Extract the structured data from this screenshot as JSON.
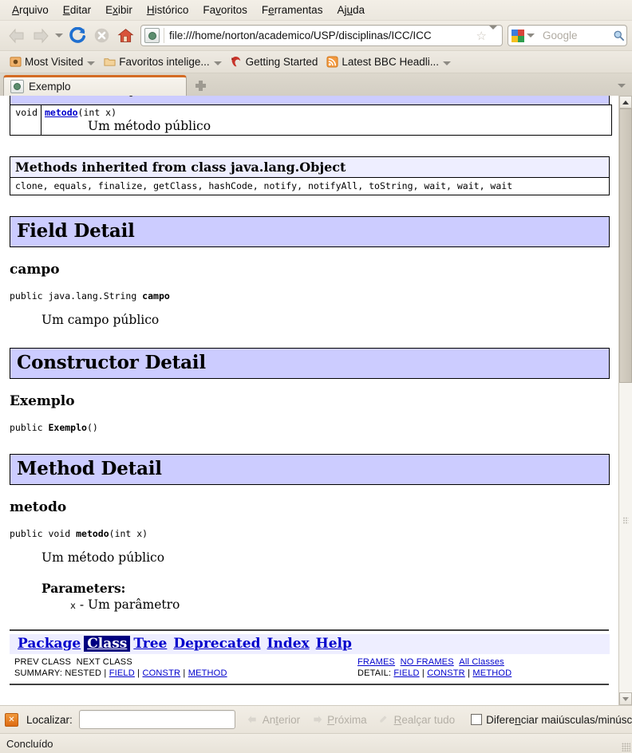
{
  "browser": {
    "menu": [
      {
        "label": "Arquivo",
        "accel_index": 0
      },
      {
        "label": "Editar",
        "accel_index": 0
      },
      {
        "label": "Exibir",
        "accel_index": 1
      },
      {
        "label": "Histórico",
        "accel_index": 0
      },
      {
        "label": "Favoritos",
        "accel_index": 2
      },
      {
        "label": "Ferramentas",
        "accel_index": 1
      },
      {
        "label": "Ajuda",
        "accel_index": 1
      }
    ],
    "toolbar": {
      "back_icon": "back-arrow-icon",
      "forward_icon": "forward-arrow-icon",
      "history_dropdown_icon": "chevron-down-icon",
      "reload_icon": "reload-icon",
      "stop_icon": "stop-icon",
      "home_icon": "home-icon"
    },
    "url": {
      "value": "file:///home/norton/academico/USP/disciplinas/ICC/ICC",
      "favicon": "page-icon",
      "star_icon": "bookmark-star-icon",
      "dropdown_icon": "chevron-down-icon"
    },
    "search": {
      "engine": "google-icon",
      "placeholder": "Google",
      "value": "",
      "go_icon": "magnifier-icon"
    },
    "bookmarks": [
      {
        "label": "Most Visited",
        "icon": "most-visited-icon",
        "has_caret": true
      },
      {
        "label": "Favoritos intelige...",
        "icon": "folder-icon",
        "has_caret": true
      },
      {
        "label": "Getting Started",
        "icon": "firefox-icon",
        "has_caret": false
      },
      {
        "label": "Latest BBC Headli...",
        "icon": "rss-feed-icon",
        "has_caret": true
      }
    ],
    "tabs": [
      {
        "label": "Exemplo",
        "icon": "page-icon",
        "active": true
      }
    ],
    "new_tab_icon": "plus-icon",
    "tab_list_icon": "chevron-down-icon"
  },
  "findbar": {
    "close_icon": "close-icon",
    "label": "Localizar:",
    "input_value": "",
    "prev_label": "Anterior",
    "prev_icon": "arrow-left-icon",
    "next_label": "Próxima",
    "next_icon": "arrow-right-icon",
    "highlight_label": "Realçar tudo",
    "highlight_icon": "highlight-icon",
    "match_case_label": "Diferenciar maiúsculas/minúscu",
    "match_case_checked": false
  },
  "statusbar": {
    "text": "Concluído",
    "resize_grip_icon": "resize-grip-icon"
  },
  "scrollbar": {
    "up_icon": "scroll-up-arrow-icon",
    "down_icon": "scroll-down-arrow-icon",
    "thumb_position_percent": 0
  },
  "page": {
    "method_summary_row": {
      "return_type": "void",
      "signature_link": "metodo",
      "signature_rest": "(int x)",
      "description": "Um método público"
    },
    "inherited": {
      "title": "Methods inherited from class java.lang.Object",
      "members": "clone, equals, finalize, getClass, hashCode, notify, notifyAll, toString, wait, wait, wait"
    },
    "field_detail": {
      "section_title": "Field Detail",
      "name": "campo",
      "signature_prefix": "public java.lang.String ",
      "signature_name": "campo",
      "description": "Um campo público"
    },
    "constructor_detail": {
      "section_title": "Constructor Detail",
      "name": "Exemplo",
      "signature_prefix": "public ",
      "signature_name": "Exemplo",
      "signature_suffix": "()"
    },
    "method_detail": {
      "section_title": "Method Detail",
      "name": "metodo",
      "signature_prefix": "public void ",
      "signature_name": "metodo",
      "signature_suffix": "(int x)",
      "description": "Um método público",
      "params_title": "Parameters:",
      "param_name": "x",
      "param_dash": " - ",
      "param_desc": "Um parâmetro"
    },
    "nav": {
      "links": [
        {
          "label": "Package",
          "active": false
        },
        {
          "label": "Class",
          "active": true
        },
        {
          "label": "Tree",
          "active": false
        },
        {
          "label": "Deprecated",
          "active": false
        },
        {
          "label": "Index",
          "active": false
        },
        {
          "label": "Help",
          "active": false
        }
      ],
      "prev_class": "PREV CLASS",
      "next_class": "NEXT CLASS",
      "summary_label": "SUMMARY: NESTED | ",
      "summary_links": [
        "FIELD",
        "CONSTR",
        "METHOD"
      ],
      "frames": "FRAMES",
      "no_frames": "NO FRAMES",
      "all_classes": "All Classes",
      "detail_label": "DETAIL: ",
      "detail_links": [
        "FIELD",
        "CONSTR",
        "METHOD"
      ]
    }
  },
  "colors": {
    "section_bar_bg": "#CCCCFF",
    "inherited_header_bg": "#EEEEFF",
    "nav_active_bg": "#000080",
    "link": "#0000CC",
    "tab_accent": "#D46B24"
  }
}
